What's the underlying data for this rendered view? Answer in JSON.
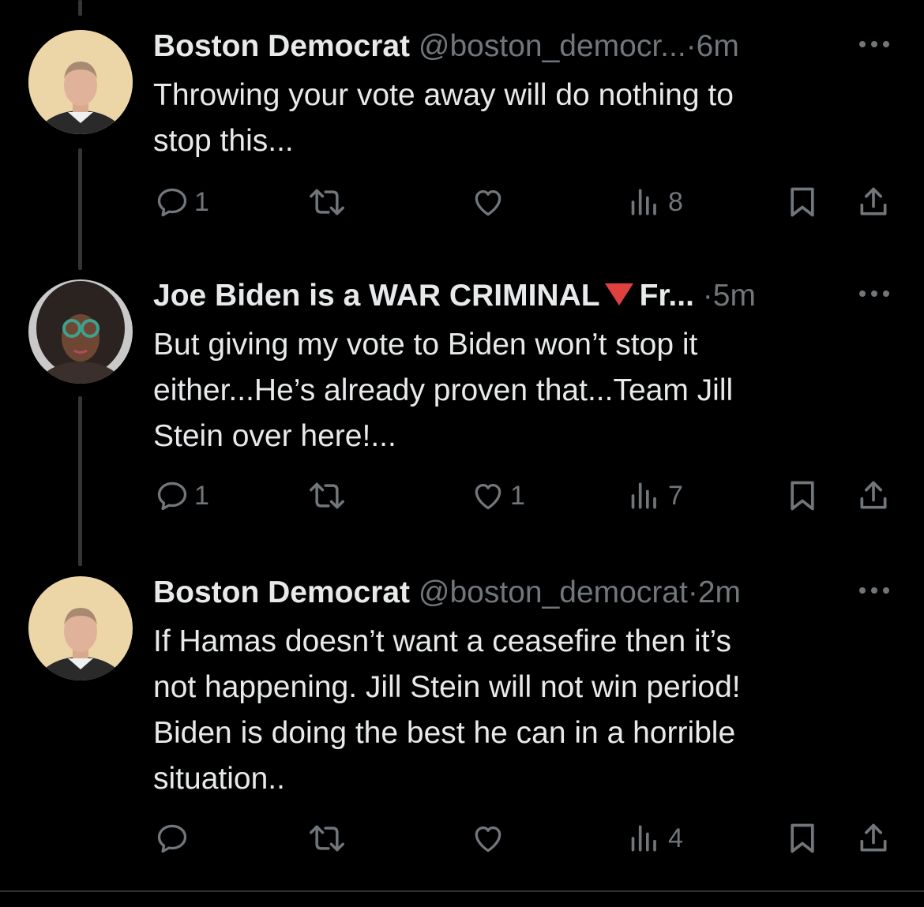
{
  "colors": {
    "background": "#000000",
    "text": "#e7e9ea",
    "muted": "#71767b",
    "thread_line": "#333639",
    "triangle": "#e0413f"
  },
  "tweets": [
    {
      "name": "Boston Democrat",
      "handle": "@boston_democr...",
      "dot": "·",
      "time": "6m",
      "lines": [
        "Throwing your vote away will do nothing to",
        "stop this..."
      ],
      "reply_count": "1",
      "retweet_count": "",
      "like_count": "",
      "views_count": "8",
      "avatar": "man-headshot-avatar"
    },
    {
      "name": "Joe Biden is a WAR CRIMINAL",
      "name_suffix": "Fr...",
      "name_emoji": "red-triangle-down-icon",
      "handle": "",
      "dot": "·",
      "time": "5m",
      "lines": [
        "But giving my vote to Biden won’t stop it",
        "either...He’s already proven that...Team Jill",
        "Stein over here!..."
      ],
      "reply_count": "1",
      "retweet_count": "",
      "like_count": "1",
      "views_count": "7",
      "avatar": "woman-headshot-avatar"
    },
    {
      "name": "Boston Democrat",
      "handle": "@boston_democrat",
      "dot": "·",
      "time": "2m",
      "lines": [
        "If Hamas doesn’t want a ceasefire then it’s",
        "not happening. Jill Stein will not win period!",
        "Biden is doing the best he can in a horrible",
        "situation.."
      ],
      "reply_count": "",
      "retweet_count": "",
      "like_count": "",
      "views_count": "4",
      "avatar": "man-headshot-avatar"
    }
  ]
}
